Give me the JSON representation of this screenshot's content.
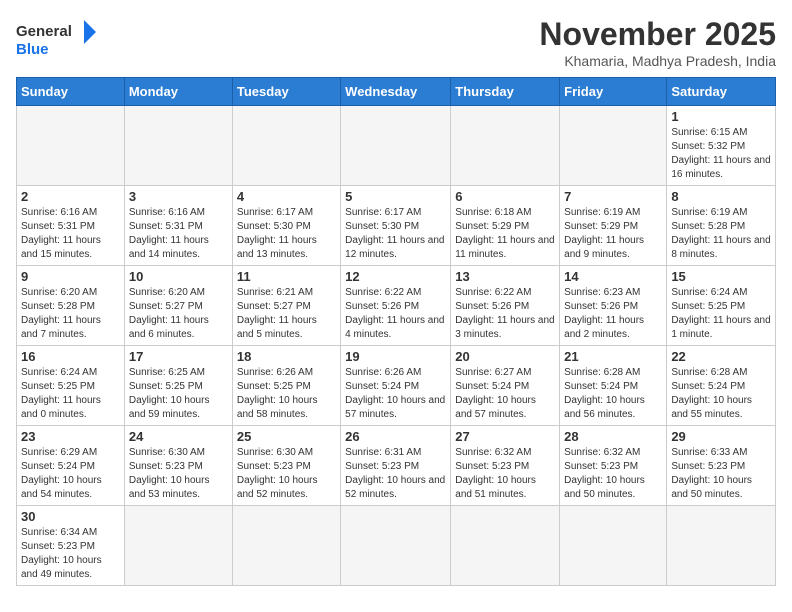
{
  "header": {
    "logo_general": "General",
    "logo_blue": "Blue",
    "month_title": "November 2025",
    "subtitle": "Khamaria, Madhya Pradesh, India"
  },
  "weekdays": [
    "Sunday",
    "Monday",
    "Tuesday",
    "Wednesday",
    "Thursday",
    "Friday",
    "Saturday"
  ],
  "weeks": [
    [
      {
        "day": "",
        "info": ""
      },
      {
        "day": "",
        "info": ""
      },
      {
        "day": "",
        "info": ""
      },
      {
        "day": "",
        "info": ""
      },
      {
        "day": "",
        "info": ""
      },
      {
        "day": "",
        "info": ""
      },
      {
        "day": "1",
        "info": "Sunrise: 6:15 AM\nSunset: 5:32 PM\nDaylight: 11 hours and 16 minutes."
      }
    ],
    [
      {
        "day": "2",
        "info": "Sunrise: 6:16 AM\nSunset: 5:31 PM\nDaylight: 11 hours and 15 minutes."
      },
      {
        "day": "3",
        "info": "Sunrise: 6:16 AM\nSunset: 5:31 PM\nDaylight: 11 hours and 14 minutes."
      },
      {
        "day": "4",
        "info": "Sunrise: 6:17 AM\nSunset: 5:30 PM\nDaylight: 11 hours and 13 minutes."
      },
      {
        "day": "5",
        "info": "Sunrise: 6:17 AM\nSunset: 5:30 PM\nDaylight: 11 hours and 12 minutes."
      },
      {
        "day": "6",
        "info": "Sunrise: 6:18 AM\nSunset: 5:29 PM\nDaylight: 11 hours and 11 minutes."
      },
      {
        "day": "7",
        "info": "Sunrise: 6:19 AM\nSunset: 5:29 PM\nDaylight: 11 hours and 9 minutes."
      },
      {
        "day": "8",
        "info": "Sunrise: 6:19 AM\nSunset: 5:28 PM\nDaylight: 11 hours and 8 minutes."
      }
    ],
    [
      {
        "day": "9",
        "info": "Sunrise: 6:20 AM\nSunset: 5:28 PM\nDaylight: 11 hours and 7 minutes."
      },
      {
        "day": "10",
        "info": "Sunrise: 6:20 AM\nSunset: 5:27 PM\nDaylight: 11 hours and 6 minutes."
      },
      {
        "day": "11",
        "info": "Sunrise: 6:21 AM\nSunset: 5:27 PM\nDaylight: 11 hours and 5 minutes."
      },
      {
        "day": "12",
        "info": "Sunrise: 6:22 AM\nSunset: 5:26 PM\nDaylight: 11 hours and 4 minutes."
      },
      {
        "day": "13",
        "info": "Sunrise: 6:22 AM\nSunset: 5:26 PM\nDaylight: 11 hours and 3 minutes."
      },
      {
        "day": "14",
        "info": "Sunrise: 6:23 AM\nSunset: 5:26 PM\nDaylight: 11 hours and 2 minutes."
      },
      {
        "day": "15",
        "info": "Sunrise: 6:24 AM\nSunset: 5:25 PM\nDaylight: 11 hours and 1 minute."
      }
    ],
    [
      {
        "day": "16",
        "info": "Sunrise: 6:24 AM\nSunset: 5:25 PM\nDaylight: 11 hours and 0 minutes."
      },
      {
        "day": "17",
        "info": "Sunrise: 6:25 AM\nSunset: 5:25 PM\nDaylight: 10 hours and 59 minutes."
      },
      {
        "day": "18",
        "info": "Sunrise: 6:26 AM\nSunset: 5:25 PM\nDaylight: 10 hours and 58 minutes."
      },
      {
        "day": "19",
        "info": "Sunrise: 6:26 AM\nSunset: 5:24 PM\nDaylight: 10 hours and 57 minutes."
      },
      {
        "day": "20",
        "info": "Sunrise: 6:27 AM\nSunset: 5:24 PM\nDaylight: 10 hours and 57 minutes."
      },
      {
        "day": "21",
        "info": "Sunrise: 6:28 AM\nSunset: 5:24 PM\nDaylight: 10 hours and 56 minutes."
      },
      {
        "day": "22",
        "info": "Sunrise: 6:28 AM\nSunset: 5:24 PM\nDaylight: 10 hours and 55 minutes."
      }
    ],
    [
      {
        "day": "23",
        "info": "Sunrise: 6:29 AM\nSunset: 5:24 PM\nDaylight: 10 hours and 54 minutes."
      },
      {
        "day": "24",
        "info": "Sunrise: 6:30 AM\nSunset: 5:23 PM\nDaylight: 10 hours and 53 minutes."
      },
      {
        "day": "25",
        "info": "Sunrise: 6:30 AM\nSunset: 5:23 PM\nDaylight: 10 hours and 52 minutes."
      },
      {
        "day": "26",
        "info": "Sunrise: 6:31 AM\nSunset: 5:23 PM\nDaylight: 10 hours and 52 minutes."
      },
      {
        "day": "27",
        "info": "Sunrise: 6:32 AM\nSunset: 5:23 PM\nDaylight: 10 hours and 51 minutes."
      },
      {
        "day": "28",
        "info": "Sunrise: 6:32 AM\nSunset: 5:23 PM\nDaylight: 10 hours and 50 minutes."
      },
      {
        "day": "29",
        "info": "Sunrise: 6:33 AM\nSunset: 5:23 PM\nDaylight: 10 hours and 50 minutes."
      }
    ],
    [
      {
        "day": "30",
        "info": "Sunrise: 6:34 AM\nSunset: 5:23 PM\nDaylight: 10 hours and 49 minutes."
      },
      {
        "day": "",
        "info": ""
      },
      {
        "day": "",
        "info": ""
      },
      {
        "day": "",
        "info": ""
      },
      {
        "day": "",
        "info": ""
      },
      {
        "day": "",
        "info": ""
      },
      {
        "day": "",
        "info": ""
      }
    ]
  ]
}
